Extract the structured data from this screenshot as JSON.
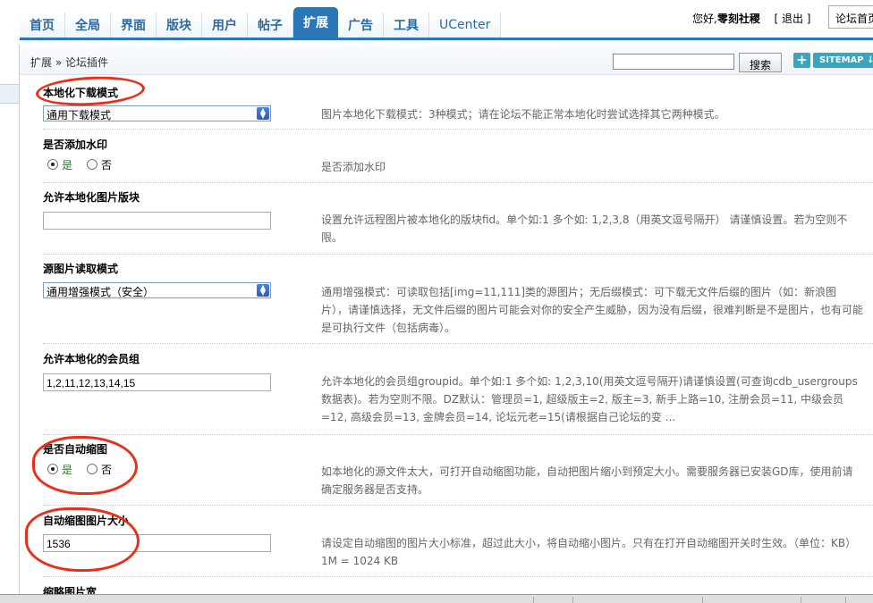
{
  "nav": {
    "items": [
      {
        "label": "首页",
        "active": false
      },
      {
        "label": "全局",
        "active": false
      },
      {
        "label": "界面",
        "active": false
      },
      {
        "label": "版块",
        "active": false
      },
      {
        "label": "用户",
        "active": false
      },
      {
        "label": "帖子",
        "active": false
      },
      {
        "label": "扩展",
        "active": true
      },
      {
        "label": "广告",
        "active": false
      },
      {
        "label": "工具",
        "active": false
      },
      {
        "label": "UCenter",
        "active": false
      }
    ]
  },
  "header": {
    "greeting_prefix": "您好,",
    "username": "零刻社稷",
    "logout_label": "[ 退出 ]",
    "forum_home_label": "论坛首页"
  },
  "breadcrumb": {
    "text": "扩展 » 论坛插件"
  },
  "search": {
    "value": "",
    "button_label": "搜索"
  },
  "toolbar": {
    "plus_label": "+",
    "sitemap_label": "SITEMAP ↓"
  },
  "settings": [
    {
      "title": "本地化下载模式",
      "type": "select",
      "value": "通用下载模式",
      "description": "图片本地化下载模式：3种模式；请在论坛不能正常本地化时尝试选择其它两种模式。"
    },
    {
      "title": "是否添加水印",
      "type": "radio",
      "yes_label": "是",
      "no_label": "否",
      "selected": "yes",
      "description": "是否添加水印"
    },
    {
      "title": "允许本地化图片版块",
      "type": "text",
      "value": "",
      "description": "设置允许远程图片被本地化的版块fid。单个如:1 多个如: 1,2,3,8（用英文逗号隔开） 请谨慎设置。若为空则不限。"
    },
    {
      "title": "源图片读取模式",
      "type": "select",
      "value": "通用增强模式（安全）",
      "description": "通用增强模式：可读取包括[img=11,111]类的源图片；无后缀模式：可下载无文件后缀的图片（如：新浪图片），请谨慎选择，无文件后缀的图片可能会对你的安全产生威胁，因为没有后缀，很难判断是不是图片，也有可能是可执行文件（包括病毒）。"
    },
    {
      "title": "允许本地化的会员组",
      "type": "text",
      "value": "1,2,11,12,13,14,15",
      "description": "允许本地化的会员组groupid。单个如:1 多个如: 1,2,3,10(用英文逗号隔开)请谨慎设置(可查询cdb_usergroups数据表)。若为空则不限。DZ默认：管理员=1, 超级版主=2, 版主=3, 新手上路=10, 注册会员=11, 中级会员=12, 高级会员=13, 金牌会员=14, 论坛元老=15(请根据自己论坛的变 ..."
    },
    {
      "title": "是否自动缩图",
      "type": "radio",
      "yes_label": "是",
      "no_label": "否",
      "selected": "yes",
      "description": "如本地化的源文件太大，可打开自动缩图功能，自动把图片缩小到预定大小。需要服务器已安装GD库，使用前请确定服务器是否支持。"
    },
    {
      "title": "自动缩图图片大小",
      "type": "text",
      "value": "1536",
      "description": "请设定自动缩图的图片大小标准，超过此大小，将自动缩小图片。只有在打开自动缩图开关时生效。（单位：KB） 1M = 1024 KB"
    },
    {
      "title": "缩略图片宽"
    }
  ],
  "colors": {
    "nav_active_bg": "#2a77b7",
    "nav_text": "#2a6aa6",
    "annotation_red": "#e8301a",
    "sitemap_bg": "#3aa6bd"
  }
}
